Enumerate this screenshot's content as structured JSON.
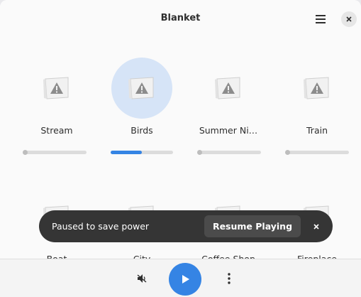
{
  "window": {
    "title": "Blanket"
  },
  "header": {
    "menu_icon": "hamburger-menu-icon",
    "close_icon": "close-icon"
  },
  "sounds": [
    {
      "name": "Stream",
      "volume": 0.0,
      "active": false
    },
    {
      "name": "Birds",
      "volume": 0.5,
      "active": true
    },
    {
      "name": "Summer Ni…",
      "volume": 0.0,
      "active": false
    },
    {
      "name": "Train",
      "volume": 0.0,
      "active": false
    },
    {
      "name": "Boat",
      "active": false
    },
    {
      "name": "City",
      "active": false
    },
    {
      "name": "Coffee Shop",
      "active": false
    },
    {
      "name": "Fireplace",
      "active": false
    }
  ],
  "toast": {
    "message": "Paused to save power",
    "action_label": "Resume Playing",
    "dismiss_icon": "close-icon"
  },
  "bottombar": {
    "volume_icon": "speaker-muted-icon",
    "play_icon": "play-icon",
    "more_icon": "vertical-dots-icon"
  },
  "colors": {
    "accent": "#3584e4",
    "active_bg": "#d6e4f7",
    "toast_bg": "#353535"
  }
}
